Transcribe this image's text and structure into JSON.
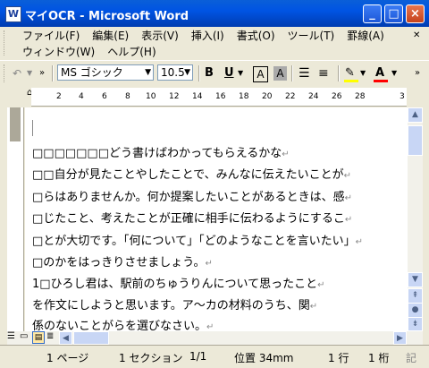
{
  "window": {
    "title": "マイOCR - Microsoft Word",
    "app_icon": "W"
  },
  "window_controls": {
    "minimize": "_",
    "maximize": "□",
    "close": "×"
  },
  "menus_row1": [
    "ファイル(F)",
    "編集(E)",
    "表示(V)",
    "挿入(I)",
    "書式(O)",
    "ツール(T)",
    "罫線(A)"
  ],
  "menus_row2": [
    "ウィンドウ(W)",
    "ヘルプ(H)"
  ],
  "toolbar": {
    "font_name": "MS ゴシック",
    "font_size": "10.5",
    "bold": "B",
    "underline": "U",
    "char_border": "A",
    "char_shading": "A",
    "font_color_label": "A"
  },
  "ruler": {
    "ticks": [
      "2",
      "4",
      "6",
      "8",
      "10",
      "12",
      "14",
      "16",
      "18",
      "20",
      "22",
      "24",
      "26",
      "28",
      "3"
    ]
  },
  "document": {
    "lines": [
      "□□□□□□□どう書けばわかってもらえるかな",
      "□□自分が見たことやしたことで、みんなに伝えたいことが",
      "□らはありませんか。何か提案したいことがあるときは、感",
      "□じたこと、考えたことが正確に相手に伝わるようにするこ",
      "□とが大切です。「何について」「どのようなことを言いたい」",
      "□のかをはっきりさせましょう。",
      "1□ひろし君は、駅前のちゅうりんについて思ったこと",
      "を作文にしようと思います。ア～カの材料のうち、関",
      "係のないことがらを選びなさい。"
    ],
    "return_mark": "↵"
  },
  "status": {
    "page": "1 ページ",
    "section": "1 セクション",
    "pages": "1/1",
    "position": "位置 34mm",
    "line": "1 行",
    "column": "1 桁",
    "rec": "記"
  },
  "colors": {
    "title_bar": "#0054e3",
    "close_button": "#e04a1f",
    "highlight": "#ffff00",
    "font_color": "#ff0000"
  }
}
